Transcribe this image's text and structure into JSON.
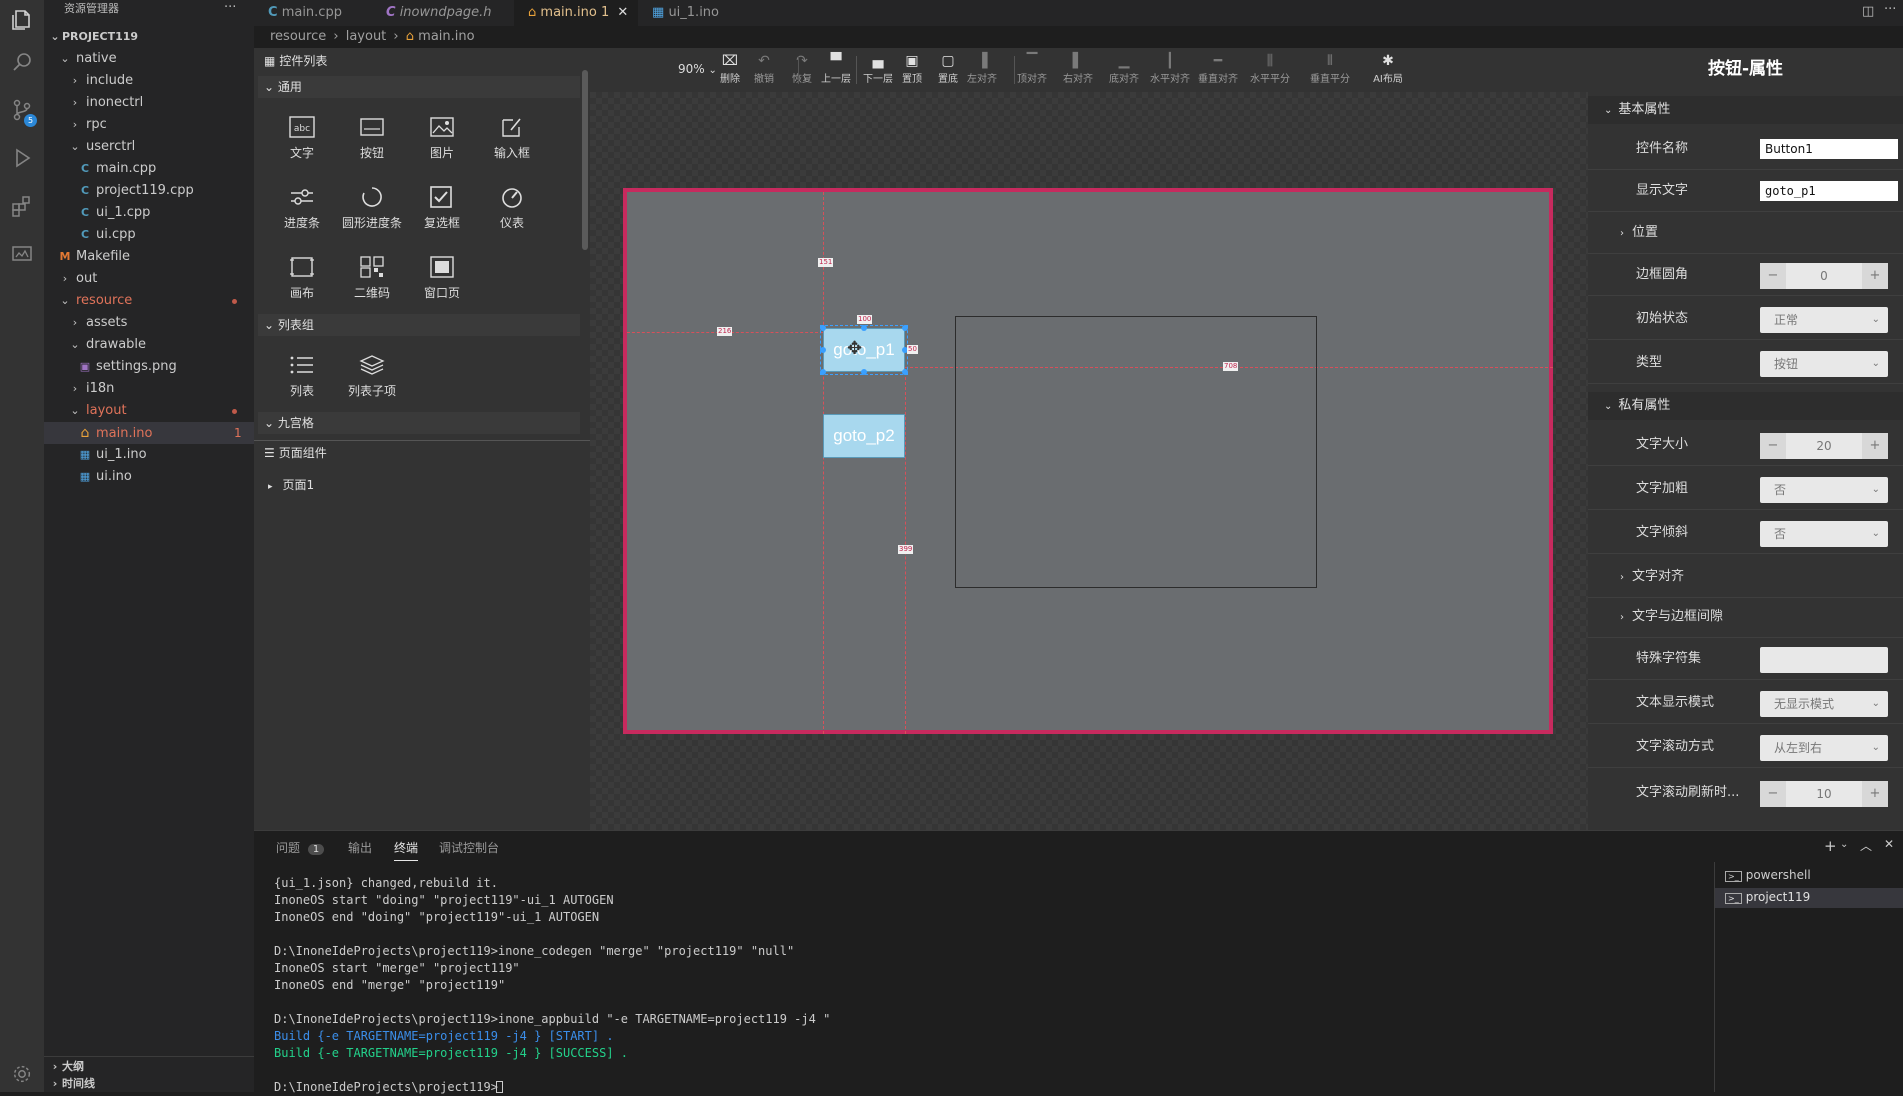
{
  "explorer": {
    "title": "资源管理器",
    "project": "PROJECT119",
    "items": [
      {
        "label": "native",
        "kind": "folder-open"
      },
      {
        "label": "include",
        "kind": "folder"
      },
      {
        "label": "inonectrl",
        "kind": "folder"
      },
      {
        "label": "rpc",
        "kind": "folder"
      },
      {
        "label": "userctrl",
        "kind": "folder-open"
      },
      {
        "label": "main.cpp",
        "kind": "cpp"
      },
      {
        "label": "project119.cpp",
        "kind": "cpp"
      },
      {
        "label": "ui_1.cpp",
        "kind": "cpp"
      },
      {
        "label": "ui.cpp",
        "kind": "cpp"
      },
      {
        "label": "Makefile",
        "kind": "make"
      },
      {
        "label": "out",
        "kind": "folder"
      },
      {
        "label": "resource",
        "kind": "folder-open"
      },
      {
        "label": "assets",
        "kind": "folder"
      },
      {
        "label": "drawable",
        "kind": "folder-open"
      },
      {
        "label": "settings.png",
        "kind": "image"
      },
      {
        "label": "i18n",
        "kind": "folder"
      },
      {
        "label": "layout",
        "kind": "folder-open"
      },
      {
        "label": "main.ino",
        "kind": "home"
      },
      {
        "label": "ui_1.ino",
        "kind": "ino"
      },
      {
        "label": "ui.ino",
        "kind": "ino"
      }
    ],
    "main_ino_badge": "1",
    "outline": "大纲",
    "timeline": "时间线"
  },
  "tabs": [
    {
      "label": "main.cpp"
    },
    {
      "label": "inowndpage.h"
    },
    {
      "label": "main.ino",
      "badge": "1"
    },
    {
      "label": "ui_1.ino"
    }
  ],
  "breadcrumb": [
    "resource",
    "layout",
    "main.ino"
  ],
  "palette": {
    "title": "控件列表",
    "section_common": "通用",
    "common": [
      "文字",
      "按钮",
      "图片",
      "输入框",
      "进度条",
      "圆形进度条",
      "复选框",
      "仪表",
      "画布",
      "二维码",
      "窗口页"
    ],
    "section_list": "列表组",
    "list": [
      "列表",
      "列表子项"
    ],
    "section_grid": "九宫格",
    "page_components": "页面组件",
    "page1": "页面1"
  },
  "toolbar": {
    "zoom": "90%",
    "buttons": [
      "删除",
      "撤销",
      "恢复",
      "上一层",
      "下一层",
      "置顶",
      "置底",
      "左对齐",
      "顶对齐",
      "右对齐",
      "底对齐",
      "水平对齐",
      "垂直对齐",
      "水平平分",
      "垂直平分",
      "AI布局"
    ]
  },
  "canvas": {
    "button1": "goto_p1",
    "button2": "goto_p2",
    "dims": [
      "151",
      "216",
      "100",
      "50",
      "708",
      "399"
    ]
  },
  "props": {
    "title": "按钮-属性",
    "basic": "基本属性",
    "name_label": "控件名称",
    "name_value": "Button1",
    "text_label": "显示文字",
    "text_value": "goto_p1",
    "position": "位置",
    "radius_label": "边框圆角",
    "radius_value": "0",
    "state_label": "初始状态",
    "state_value": "正常",
    "type_label": "类型",
    "type_value": "按钮",
    "private": "私有属性",
    "fontsize_label": "文字大小",
    "fontsize_value": "20",
    "bold_label": "文字加粗",
    "bold_value": "否",
    "italic_label": "文字倾斜",
    "italic_value": "否",
    "align": "文字对齐",
    "padding": "文字与边框间隙",
    "charset_label": "特殊字符集",
    "charset_value": "",
    "display_label": "文本显示模式",
    "display_value": "无显示模式",
    "scroll_label": "文字滚动方式",
    "scroll_value": "从左到右",
    "refresh_label": "文字滚动刷新时...",
    "refresh_value": "10"
  },
  "panel": {
    "tabs": [
      "问题",
      "输出",
      "终端",
      "调试控制台"
    ],
    "problems_count": "1",
    "terminals": [
      "powershell",
      "project119"
    ],
    "lines": [
      {
        "text": "{ui_1.json} changed,rebuild it.",
        "color": "#cccccc"
      },
      {
        "text": "InoneOS start \"doing\" \"project119\"-ui_1 AUTOGEN",
        "color": "#cccccc"
      },
      {
        "text": "InoneOS end \"doing\" \"project119\"-ui_1 AUTOGEN",
        "color": "#cccccc"
      },
      {
        "text": "",
        "color": "#cccccc"
      },
      {
        "text": "D:\\InoneIdeProjects\\project119>inone_codegen \"merge\" \"project119\" \"null\"",
        "color": "#cccccc"
      },
      {
        "text": "InoneOS start \"merge\" \"project119\"",
        "color": "#cccccc"
      },
      {
        "text": "InoneOS end \"merge\" \"project119\"",
        "color": "#cccccc"
      },
      {
        "text": "",
        "color": "#cccccc"
      },
      {
        "text": "D:\\InoneIdeProjects\\project119>inone_appbuild \"-e TARGETNAME=project119 -j4 \"",
        "color": "#cccccc"
      },
      {
        "text": "Build {-e TARGETNAME=project119 -j4 } [START] .",
        "color": "#3b8eea"
      },
      {
        "text": "Build {-e TARGETNAME=project119 -j4 } [SUCCESS] .",
        "color": "#23d18b"
      },
      {
        "text": "",
        "color": "#cccccc"
      },
      {
        "text": "D:\\InoneIdeProjects\\project119>",
        "color": "#cccccc"
      }
    ]
  },
  "colors": {
    "accent": "#c72a5e",
    "selection": "#3aa0ff",
    "resource_folder": "#e0735a"
  }
}
